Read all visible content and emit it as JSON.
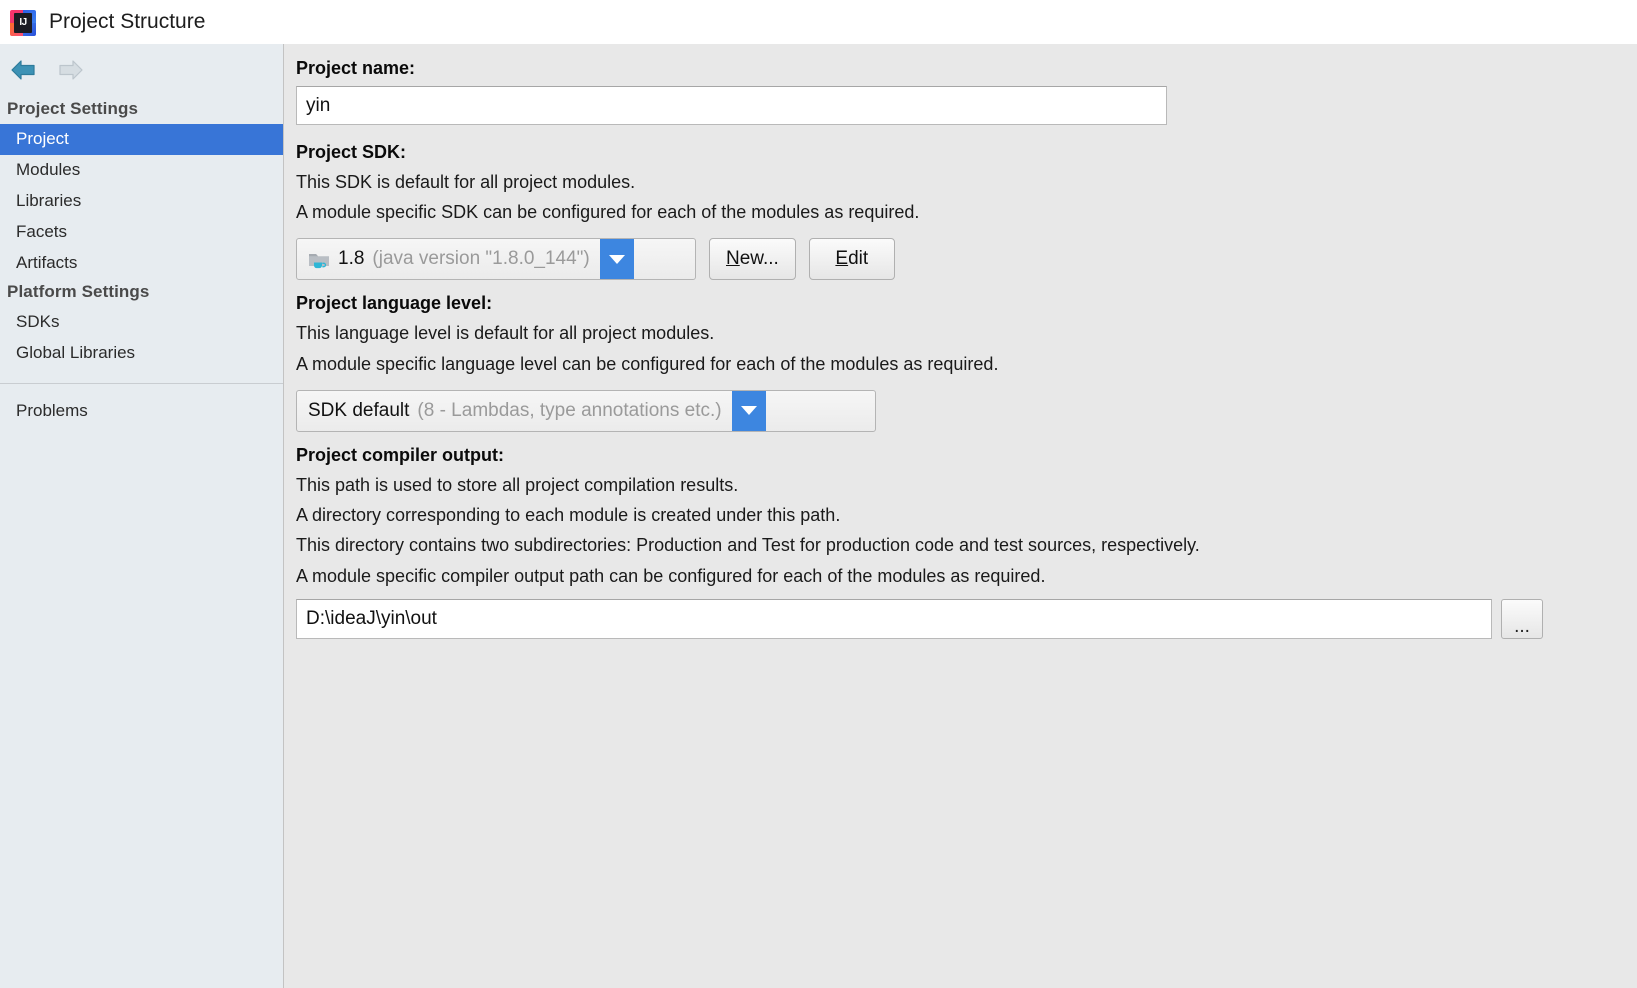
{
  "window": {
    "title": "Project Structure",
    "logo_icon": "intellij-idea-logo"
  },
  "nav": {
    "back_icon": "arrow-left-icon",
    "forward_icon": "arrow-right-icon",
    "back_enabled_color": "#3d92b5",
    "forward_disabled_color": "#c6cdd2"
  },
  "sidebar": {
    "groups": [
      {
        "title": "Project Settings",
        "items": [
          {
            "label": "Project",
            "selected": true
          },
          {
            "label": "Modules",
            "selected": false
          },
          {
            "label": "Libraries",
            "selected": false
          },
          {
            "label": "Facets",
            "selected": false
          },
          {
            "label": "Artifacts",
            "selected": false
          }
        ]
      },
      {
        "title": "Platform Settings",
        "items": [
          {
            "label": "SDKs",
            "selected": false
          },
          {
            "label": "Global Libraries",
            "selected": false
          }
        ]
      }
    ],
    "footer_items": [
      {
        "label": "Problems",
        "selected": false
      }
    ],
    "selected_color": "#3875d7"
  },
  "main": {
    "project_name": {
      "label": "Project name:",
      "value": "yin",
      "placeholder": ""
    },
    "project_sdk": {
      "label": "Project SDK:",
      "description_lines": [
        "This SDK is default for all project modules.",
        "A module specific SDK can be configured for each of the modules as required."
      ],
      "selected_icon": "java-sdk-folder-icon",
      "selected_value": "1.8",
      "selected_detail": "(java version \"1.8.0_144\")",
      "dropdown_icon": "chevron-down-icon",
      "new_button": {
        "mnemonic": "N",
        "rest": "ew..."
      },
      "edit_button": {
        "mnemonic": "E",
        "rest": "dit"
      }
    },
    "language_level": {
      "label": "Project language level:",
      "description_lines": [
        "This language level is default for all project modules.",
        "A module specific language level can be configured for each of the modules as required."
      ],
      "selected_value": "SDK default",
      "selected_detail": "(8 - Lambdas, type annotations etc.)",
      "dropdown_icon": "chevron-down-icon"
    },
    "compiler_output": {
      "label": "Project compiler output:",
      "description_lines": [
        "This path is used to store all project compilation results.",
        "A directory corresponding to each module is created under this path.",
        "This directory contains two subdirectories: Production and Test for production code and test sources, respectively.",
        "A module specific compiler output path can be configured for each of the modules as required."
      ],
      "value": "D:\\ideaJ\\yin\\out",
      "browse_button_label": "...",
      "browse_button_icon": "ellipsis-icon"
    }
  }
}
